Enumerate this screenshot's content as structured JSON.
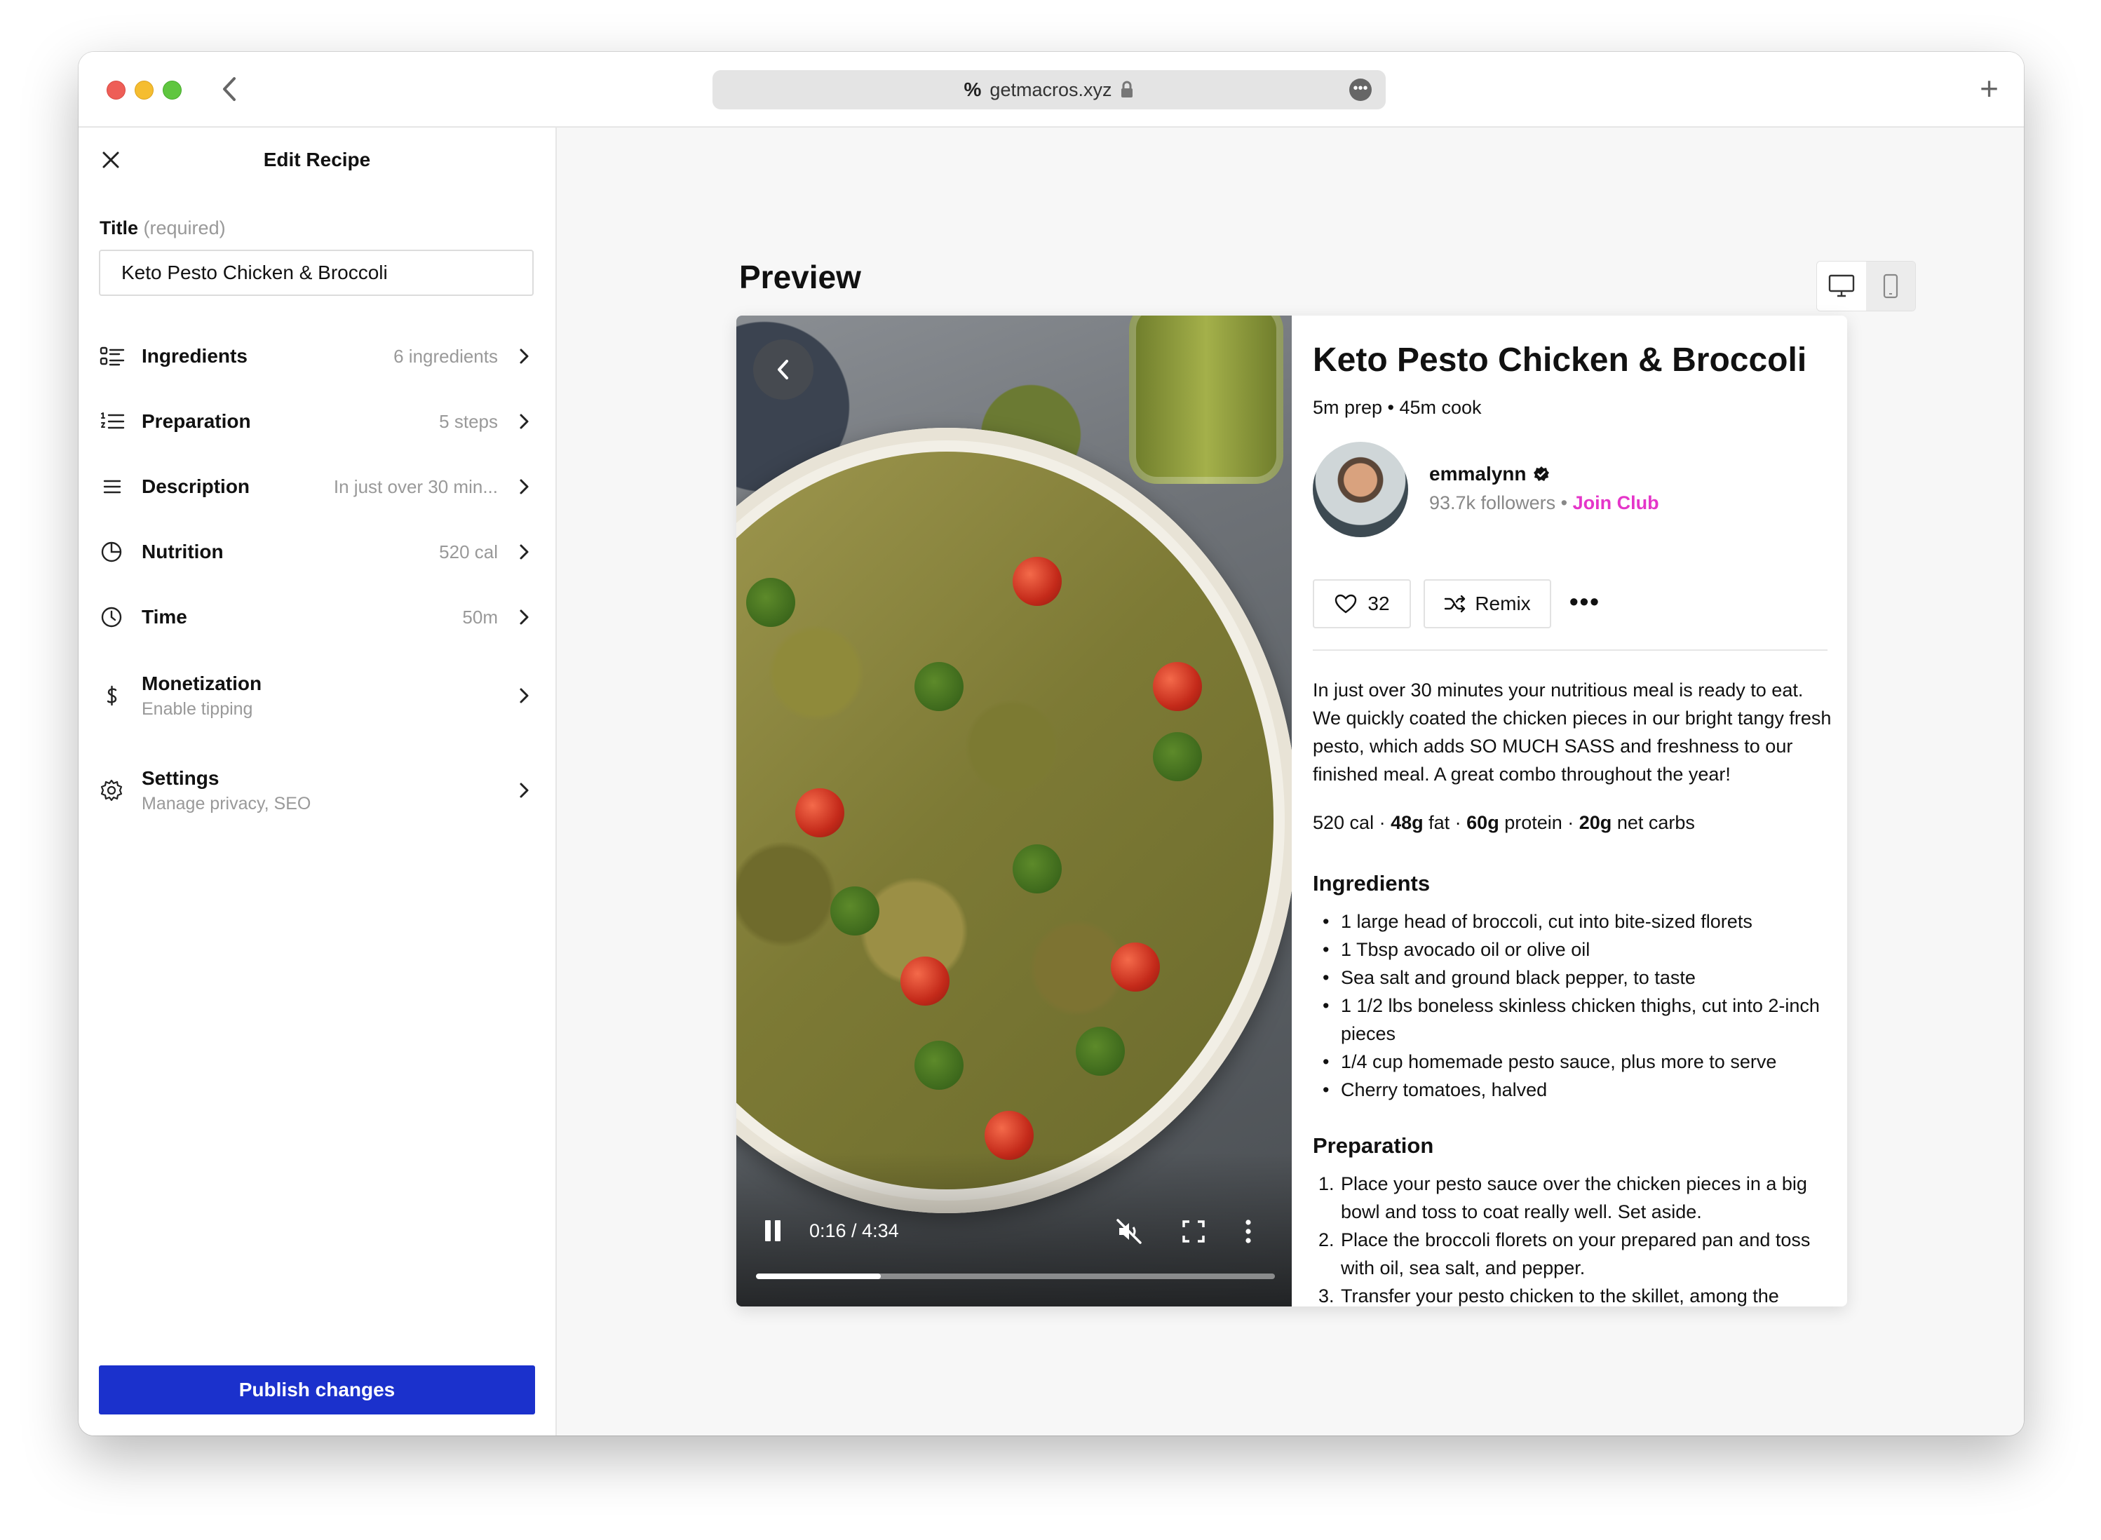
{
  "browser": {
    "url": "getmacros.xyz"
  },
  "sidebar": {
    "header_title": "Edit Recipe",
    "title_label": "Title",
    "title_required": "(required)",
    "title_value": "Keto Pesto Chicken & Broccoli",
    "items": [
      {
        "label": "Ingredients",
        "value": "6 ingredients",
        "icon": "list-icon"
      },
      {
        "label": "Preparation",
        "value": "5 steps",
        "icon": "numbered-list-icon"
      },
      {
        "label": "Description",
        "value": "In just over 30 min...",
        "icon": "menu-lines-icon"
      },
      {
        "label": "Nutrition",
        "value": "520 cal",
        "icon": "pie-chart-icon"
      },
      {
        "label": "Time",
        "value": "50m",
        "icon": "clock-icon"
      },
      {
        "label": "Monetization",
        "sublabel": "Enable tipping",
        "icon": "dollar-icon"
      },
      {
        "label": "Settings",
        "sublabel": "Manage privacy, SEO",
        "icon": "gear-icon"
      }
    ],
    "publish_label": "Publish changes"
  },
  "main": {
    "preview_title": "Preview",
    "recipe": {
      "title": "Keto Pesto Chicken & Broccoli",
      "times": "5m prep • 45m cook",
      "author": {
        "name": "emmalynn",
        "followers": "93.7k followers",
        "separator": "•",
        "join_label": "Join Club"
      },
      "likes": "32",
      "remix_label": "Remix",
      "description": "In just over 30 minutes your nutritious meal is ready to eat. We quickly coated the chicken pieces in our bright tangy fresh pesto, which adds SO MUCH SASS and freshness to our finished meal. A great combo throughout the year!",
      "macros": {
        "cal": "520 cal",
        "fat_value": "48g",
        "fat_label": "fat",
        "protein_value": "60g",
        "protein_label": "protein",
        "carbs_value": "20g",
        "carbs_label": "net carbs",
        "sep": " · "
      },
      "ingredients_heading": "Ingredients",
      "ingredients": [
        "1 large head of broccoli, cut into bite-sized florets",
        "1 Tbsp avocado oil or olive oil",
        "Sea salt and ground black pepper, to taste",
        "1 1/2 lbs boneless skinless chicken thighs, cut into 2-inch pieces",
        "1/4 cup homemade pesto sauce, plus more to serve",
        "Cherry tomatoes, halved"
      ],
      "preparation_heading": "Preparation",
      "preparation": [
        {
          "num": "1.",
          "text": "Place your pesto sauce over the chicken pieces in a big bowl and toss to coat really well. Set aside."
        },
        {
          "num": "2.",
          "text": "Place the broccoli florets on your prepared pan and toss with oil, sea salt, and pepper."
        },
        {
          "num": "3.",
          "text": "Transfer your pesto chicken to the skillet, among the"
        }
      ]
    },
    "video": {
      "timecode": "0:16 / 4:34",
      "progress": 0.24
    }
  }
}
